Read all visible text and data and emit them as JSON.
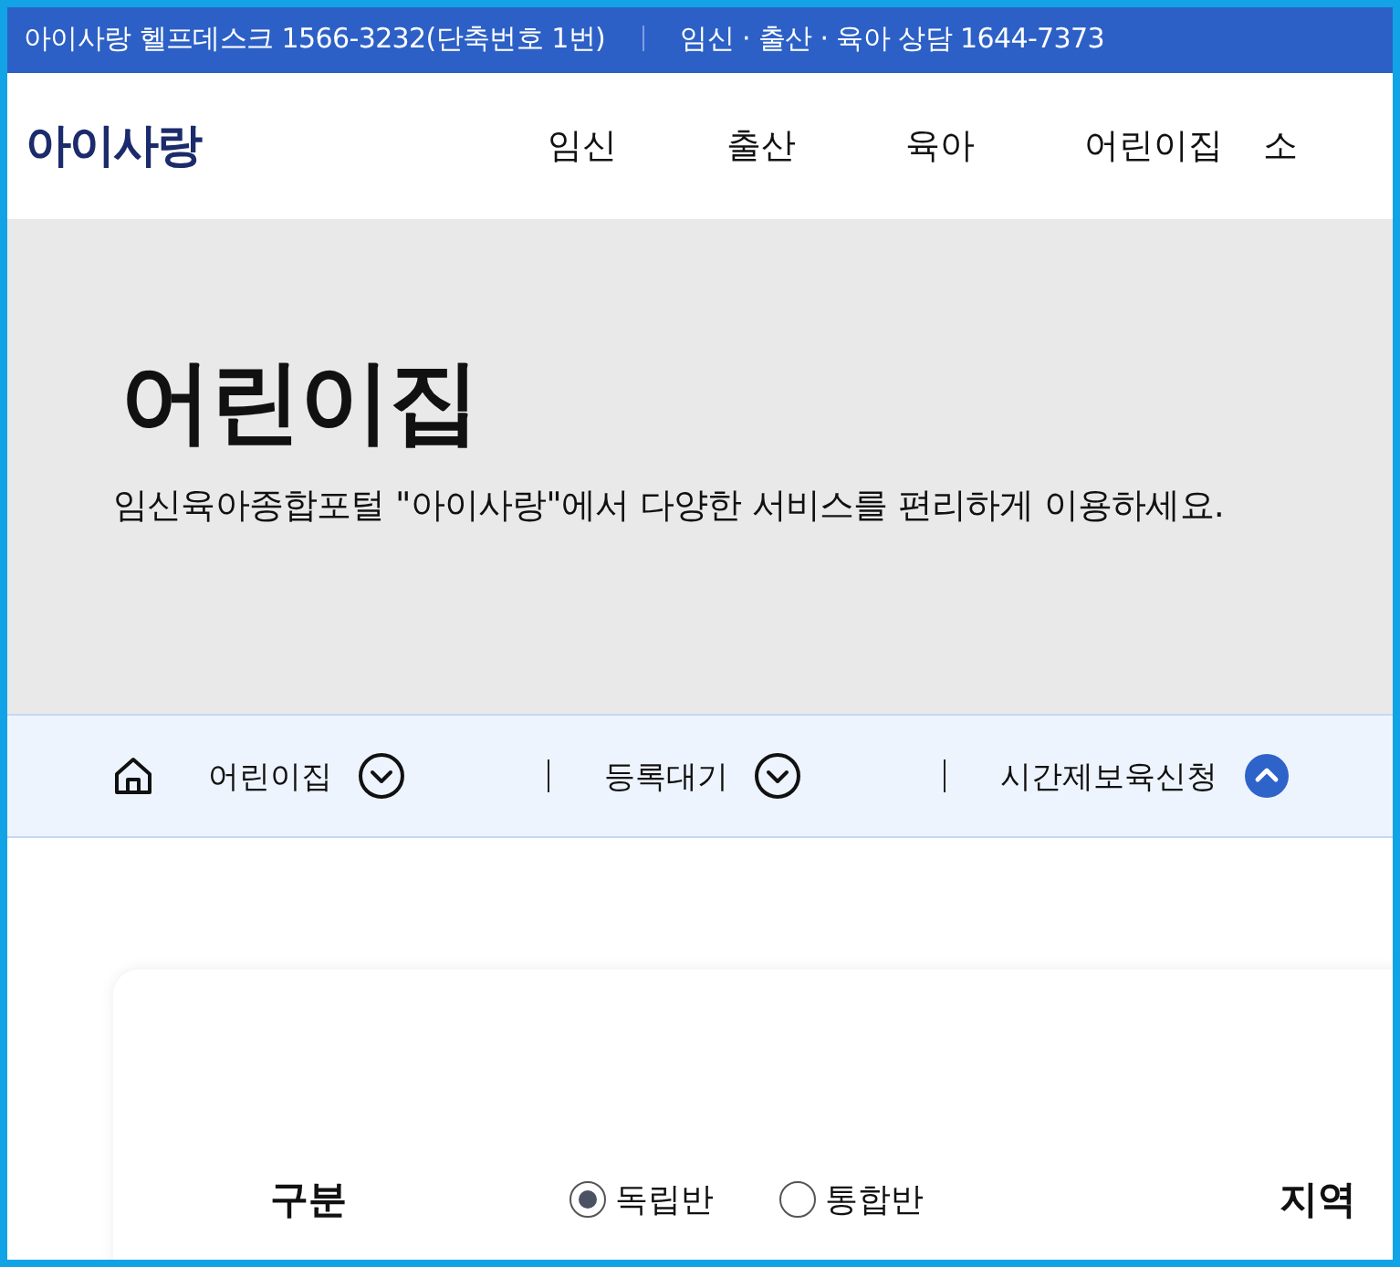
{
  "top_bar": {
    "items": [
      "아이사랑 헬프데스크 1566-3232(단축번호 1번)",
      "임신 · 출산 · 육아 상담 1644-7373"
    ]
  },
  "header": {
    "logo": "아이사랑",
    "nav": [
      "임신",
      "출산",
      "육아",
      "어린이집",
      "소"
    ]
  },
  "hero": {
    "title": "어린이집",
    "subtitle": "임신육아종합포털 \"아이사랑\"에서 다양한 서비스를 편리하게 이용하세요."
  },
  "breadcrumb": [
    {
      "label": "어린이집",
      "expanded": false
    },
    {
      "label": "등록대기",
      "expanded": false
    },
    {
      "label": "시간제보육신청",
      "expanded": true
    }
  ],
  "form": {
    "fields": [
      {
        "label": "구분",
        "options": [
          {
            "label": "독립반",
            "selected": true
          },
          {
            "label": "통합반",
            "selected": false
          }
        ]
      },
      {
        "label": "지역"
      }
    ]
  }
}
